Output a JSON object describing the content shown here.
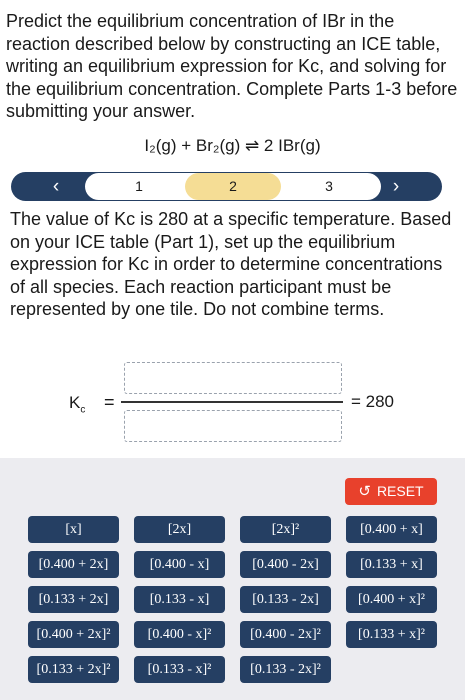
{
  "intro": "Predict the equilibrium concentration of IBr in the reaction described below by constructing an ICE table, writing an equilibrium expression for Kc, and solving for the equilibrium concentration. Complete Parts 1-3 before submitting your answer.",
  "equation": "I₂(g) + Br₂(g) ⇌ 2 IBr(g)",
  "stepper": {
    "prev_icon": "‹",
    "next_icon": "›",
    "steps": [
      "1",
      "2",
      "3"
    ],
    "active_step": "2"
  },
  "question": "The value of Kc is  280 at a specific temperature. Based on your ICE table (Part 1), set up the equilibrium expression for Kc in order to determine concentrations of all species. Each reaction participant must be represented by one tile. Do not combine terms.",
  "expression": {
    "kc_main": "K",
    "kc_sub": "c",
    "equals": "=",
    "result": "= 280"
  },
  "reset_label": "RESET",
  "tiles": [
    "[x]",
    "[2x]",
    "[2x]²",
    "[0.400 + x]",
    "[0.400 + 2x]",
    "[0.400 - x]",
    "[0.400 - 2x]",
    "[0.133 + x]",
    "[0.133 + 2x]",
    "[0.133 - x]",
    "[0.133 - 2x]",
    "[0.400 + x]²",
    "[0.400 + 2x]²",
    "[0.400 - x]²",
    "[0.400 - 2x]²",
    "[0.133 + x]²",
    "[0.133 + 2x]²",
    "[0.133 - x]²",
    "[0.133 - 2x]²"
  ]
}
